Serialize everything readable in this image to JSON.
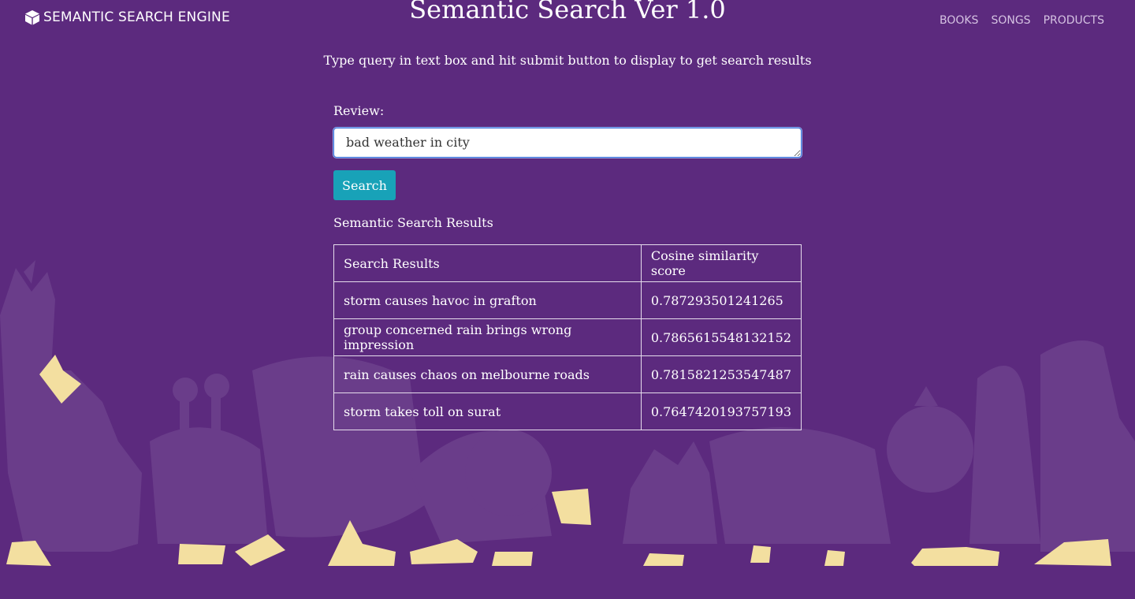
{
  "navbar": {
    "brand": "SEMANTIC SEARCH ENGINE",
    "brand_icon": "cube-icon",
    "links": [
      "BOOKS",
      "SONGS",
      "PRODUCTS"
    ]
  },
  "page": {
    "title": "Semantic Search Ver 1.0",
    "subtitle": "Type query in text box and hit submit button to display to get search results"
  },
  "form": {
    "label": "Review:",
    "query_value": "bad weather in city",
    "submit_label": "Search"
  },
  "results": {
    "heading": "Semantic Search Results",
    "columns": [
      "Search Results",
      "Cosine similarity score"
    ],
    "rows": [
      [
        "storm causes havoc in grafton",
        "0.787293501241265"
      ],
      [
        "group concerned rain brings wrong impression",
        "0.7865615548132152"
      ],
      [
        "rain causes chaos on melbourne roads",
        "0.7815821253547487"
      ],
      [
        "storm takes toll on surat",
        "0.7647420193757193"
      ]
    ]
  },
  "colors": {
    "background": "#5c2a7e",
    "silhouette": "#6a3d8a",
    "feet": "#f3dfa0",
    "button": "#18a2b8"
  }
}
